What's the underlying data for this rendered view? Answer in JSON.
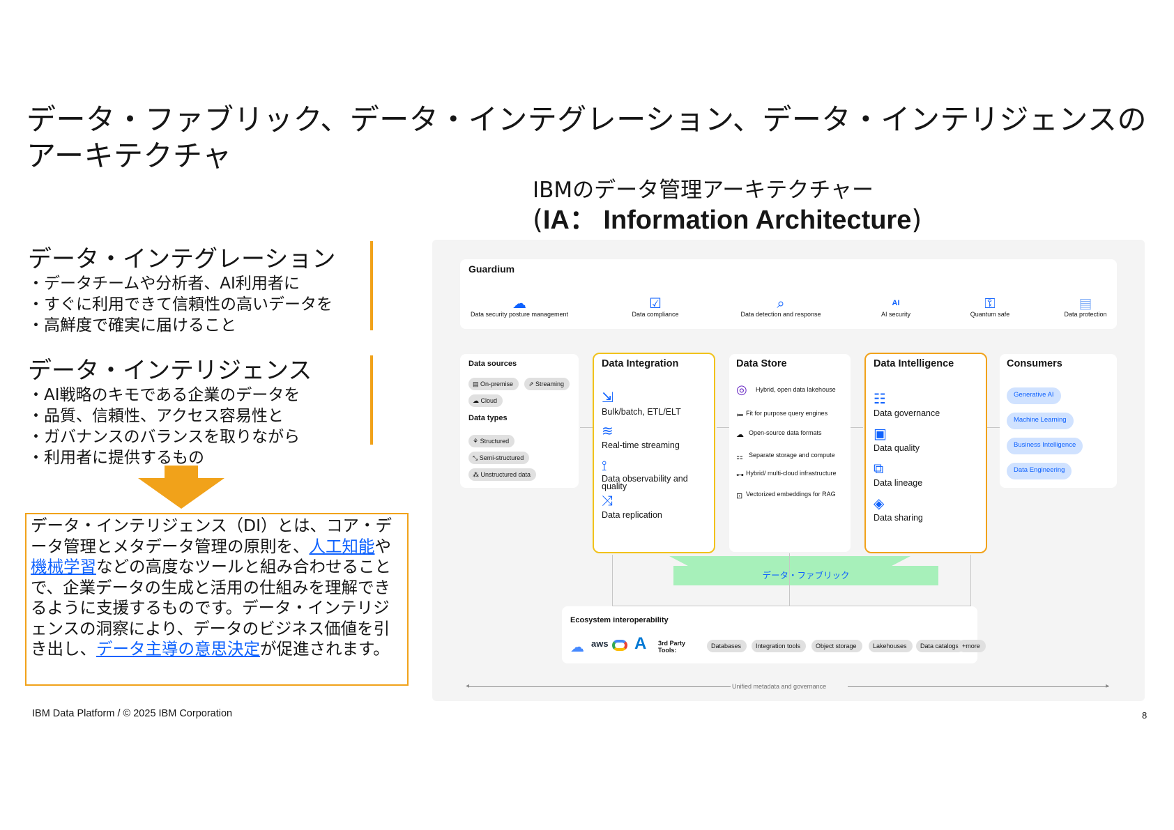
{
  "title": "データ・ファブリック、データ・インテグレーション、データ・インテリジェンスのアーキテクチャ",
  "sections": [
    {
      "heading": "データ・インテグレーション",
      "lines": [
        "・データチームや分析者、AI利用者に",
        "・すぐに利用できて信頼性の高いデータを",
        "・高鮮度で確実に届けること"
      ]
    },
    {
      "heading": "データ・インテリジェンス",
      "lines": [
        "・AI戦略のキモである企業のデータを",
        "・品質、信頼性、アクセス容易性と",
        "・ガバナンスのバランスを取りながら",
        "・利用者に提供するもの"
      ]
    }
  ],
  "definition": {
    "part1": "データ・インテリジェンス（DI）とは、コア・データ管理とメタデータ管理の原則を、",
    "link1": "人工知能",
    "part2": "や",
    "link2": "機械学習",
    "part3": "などの高度なツールと組み合わせることで、企業データの生成と活用の仕組みを理解できるように支援するものです。データ・インテリジェンスの洞察により、データのビジネス価値を引き出し、",
    "link3": "データ主導の意思決定",
    "part4": "が促進されます。"
  },
  "footer": "IBM Data Platform / © 2025 IBM Corporation",
  "page_number": "8",
  "diagram": {
    "heading_line1": "IBMのデータ管理アーキテクチャー",
    "heading_open": "(",
    "heading_bold": "IA： Information Architecture",
    "heading_close": ")",
    "guardium": {
      "title": "Guardium",
      "items": [
        {
          "label": "Data security posture management",
          "icon": "cloud-shield-icon",
          "glyph": "☁"
        },
        {
          "label": "Data compliance",
          "icon": "checklist-shield-icon",
          "glyph": "☑"
        },
        {
          "label": "Data detection and response",
          "icon": "search-shield-icon",
          "glyph": "⌕"
        },
        {
          "label": "AI security",
          "icon": "ai-shield-icon",
          "glyph": "AI"
        },
        {
          "label": "Quantum safe",
          "icon": "key-shield-icon",
          "glyph": "⚿"
        },
        {
          "label": "Data protection",
          "icon": "data-protection-icon",
          "glyph": "▤"
        }
      ]
    },
    "data_sources": {
      "title": "Data sources",
      "chips": [
        "On-premise",
        "Streaming",
        "Cloud"
      ],
      "types_title": "Data types",
      "types": [
        "Structured",
        "Semi-structured",
        "Unstructured data"
      ]
    },
    "data_integration": {
      "title": "Data Integration",
      "items": [
        {
          "label": "Bulk/batch, ETL/ELT",
          "icon": "bulk-batch-icon",
          "glyph": "⇲"
        },
        {
          "label": "Real-time streaming",
          "icon": "streaming-icon",
          "glyph": "≋"
        },
        {
          "label": "Data observability and quality",
          "icon": "observability-icon",
          "glyph": "⟟"
        },
        {
          "label": "Data replication",
          "icon": "replication-icon",
          "glyph": "⤨"
        }
      ]
    },
    "data_store": {
      "title": "Data Store",
      "items": [
        {
          "label": "Hybrid, open data lakehouse",
          "icon": "lakehouse-icon",
          "glyph": "◎"
        },
        {
          "label": "Fit for purpose query engines",
          "icon": "query-engine-icon",
          "glyph": "≔"
        },
        {
          "label": "Open-source data formats",
          "icon": "open-format-icon",
          "glyph": "☁"
        },
        {
          "label": "Separate storage and compute",
          "icon": "storage-compute-icon",
          "glyph": "⚏"
        },
        {
          "label": "Hybrid/ multi-cloud infrastructure",
          "icon": "multicloud-icon",
          "glyph": "⊶"
        },
        {
          "label": "Vectorized embeddings for RAG",
          "icon": "vector-icon",
          "glyph": "⊡"
        }
      ]
    },
    "data_intelligence": {
      "title": "Data Intelligence",
      "items": [
        {
          "label": "Data governance",
          "icon": "governance-icon",
          "glyph": "☷"
        },
        {
          "label": "Data quality",
          "icon": "quality-icon",
          "glyph": "▣"
        },
        {
          "label": "Data lineage",
          "icon": "lineage-icon",
          "glyph": "⧉"
        },
        {
          "label": "Data sharing",
          "icon": "sharing-icon",
          "glyph": "◈"
        }
      ]
    },
    "consumers": {
      "title": "Consumers",
      "items": [
        "Generative AI",
        "Machine Learning",
        "Business Intelligence",
        "Data Engineering"
      ]
    },
    "fabric_label": "データ・ファブリック",
    "ecosystem": {
      "title": "Ecosystem interoperability",
      "logos": [
        "ibm-cloud-logo",
        "aws-logo",
        "google-cloud-logo",
        "azure-logo"
      ],
      "aws_text": "aws",
      "third_party": "3rd Party Tools:",
      "tools": [
        "Databases",
        "Integration tools",
        "Object storage",
        "Lakehouses",
        "Data catalogs",
        "+more"
      ]
    },
    "metadata_label": "Unified metadata and governance"
  }
}
